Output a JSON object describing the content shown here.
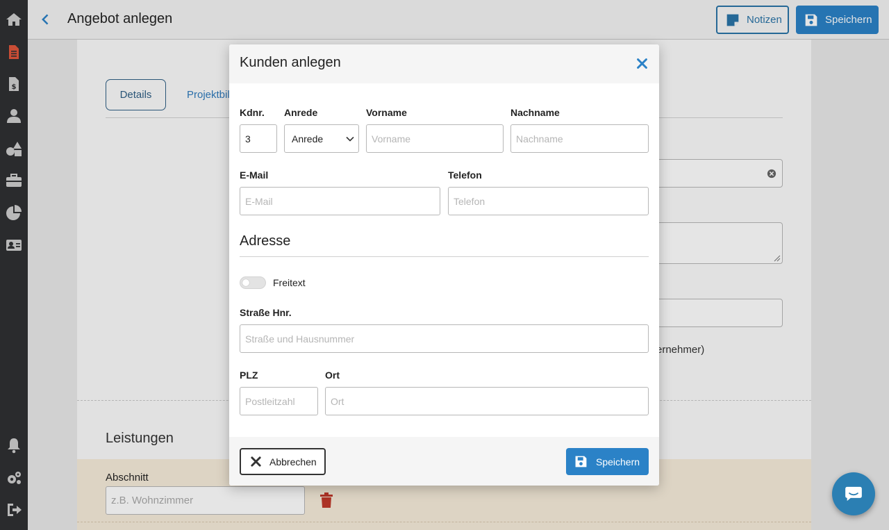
{
  "header": {
    "title": "Angebot anlegen",
    "notes_label": "Notizen",
    "save_label": "Speichern"
  },
  "sidebar": {
    "items": [
      {
        "icon": "home-icon"
      },
      {
        "icon": "document-icon"
      },
      {
        "icon": "invoice-icon"
      },
      {
        "icon": "user-icon"
      },
      {
        "icon": "shapes-icon"
      },
      {
        "icon": "toolbox-icon"
      },
      {
        "icon": "pie-chart-icon"
      },
      {
        "icon": "contact-card-icon"
      },
      {
        "icon": "bell-icon"
      },
      {
        "icon": "settings-icon"
      },
      {
        "icon": "logout-icon"
      }
    ]
  },
  "background": {
    "tabs": [
      {
        "label": "Details"
      },
      {
        "label": "Projektbil"
      }
    ],
    "partial_text": "ernehmer)",
    "leistungen_title": "Leistungen",
    "abschnitt_label": "Abschnitt",
    "abschnitt_placeholder": "z.B. Wohnzimmer"
  },
  "modal": {
    "title": "Kunden anlegen",
    "fields": {
      "kdnr": {
        "label": "Kdnr.",
        "value": "3"
      },
      "anrede": {
        "label": "Anrede",
        "selected": "Anrede"
      },
      "vorname": {
        "label": "Vorname",
        "placeholder": "Vorname"
      },
      "nachname": {
        "label": "Nachname",
        "placeholder": "Nachname"
      },
      "email": {
        "label": "E-Mail",
        "placeholder": "E-Mail"
      },
      "telefon": {
        "label": "Telefon",
        "placeholder": "Telefon"
      }
    },
    "address": {
      "title": "Adresse",
      "freitext_label": "Freitext",
      "freitext_on": false,
      "strasse": {
        "label": "Straße Hnr.",
        "placeholder": "Straße und Hausnummer"
      },
      "plz": {
        "label": "PLZ",
        "placeholder": "Postleitzahl"
      },
      "ort": {
        "label": "Ort",
        "placeholder": "Ort"
      }
    },
    "footer": {
      "cancel_label": "Abbrechen",
      "save_label": "Speichern"
    }
  },
  "colors": {
    "primary": "#2b82c7",
    "sidebar": "#2f3033",
    "danger": "#c0392b",
    "section_bg": "#f7ecdb"
  }
}
